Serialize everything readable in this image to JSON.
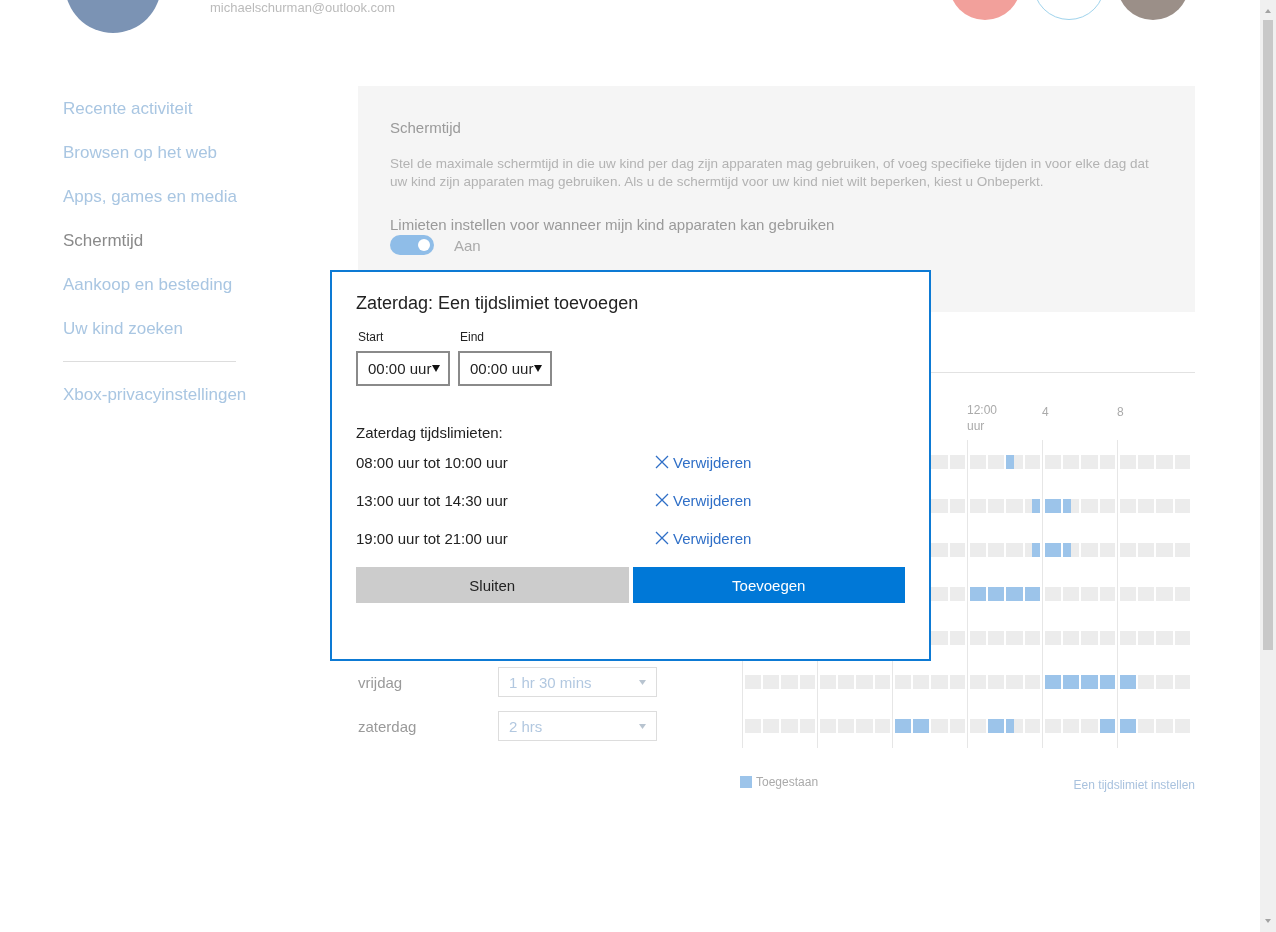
{
  "header": {
    "email": "michaelschurman@outlook.com"
  },
  "sidebar": {
    "items": [
      {
        "label": "Recente activiteit",
        "selected": false
      },
      {
        "label": "Browsen op het web",
        "selected": false
      },
      {
        "label": "Apps, games en media",
        "selected": false
      },
      {
        "label": "Schermtijd",
        "selected": true
      },
      {
        "label": "Aankoop en besteding",
        "selected": false
      },
      {
        "label": "Uw kind zoeken",
        "selected": false
      }
    ],
    "footer_items": [
      {
        "label": "Xbox-privacyinstellingen",
        "selected": false
      }
    ]
  },
  "panel": {
    "title": "Schermtijd",
    "description": "Stel de maximale schermtijd in die uw kind per dag zijn apparaten mag gebruiken, of voeg specifieke tijden in voor elke dag dat uw kind zijn apparaten mag gebruiken. Als u de schermtijd voor uw kind niet wilt beperken, kiest u Onbeperkt.",
    "setting_label": "Limieten instellen voor wanneer mijn kind apparaten kan gebruiken",
    "toggle": {
      "on": true,
      "label": "Aan"
    }
  },
  "schedule": {
    "hour_labels": [
      "12:00 uur",
      "4",
      "8"
    ],
    "rows": [
      {
        "allowed": [
          false,
          false,
          false,
          false,
          false,
          false,
          false,
          false,
          true,
          false,
          false,
          false,
          false,
          false,
          false,
          false,
          false,
          false,
          false,
          false,
          false,
          false,
          false,
          false,
          false,
          false,
          false,
          false
        ]
      },
      {
        "allowed": [
          false,
          false,
          false,
          false,
          false,
          false,
          false,
          false,
          false,
          false,
          false,
          true,
          true,
          true,
          true,
          false,
          false,
          false,
          false,
          false,
          false,
          false,
          false,
          false,
          false,
          false,
          false,
          false
        ]
      },
      {
        "allowed": [
          false,
          false,
          false,
          false,
          false,
          false,
          false,
          false,
          false,
          false,
          false,
          true,
          true,
          true,
          true,
          false,
          false,
          false,
          false,
          false,
          false,
          false,
          false,
          false,
          false,
          false,
          false,
          false
        ]
      },
      {
        "allowed": [
          false,
          false,
          false,
          false,
          true,
          true,
          true,
          true,
          true,
          true,
          true,
          true,
          false,
          false,
          false,
          false,
          false,
          false,
          false,
          false,
          false,
          false,
          false,
          false,
          false,
          false,
          false,
          false
        ]
      },
      {
        "allowed": [
          false,
          false,
          false,
          false,
          false,
          false,
          false,
          false,
          false,
          false,
          false,
          false,
          false,
          false,
          false,
          false,
          false,
          false,
          false,
          false,
          false,
          false,
          false,
          false,
          false,
          false,
          false,
          false
        ]
      },
      {
        "day": "vrijdag",
        "limit": "1 hr 30 mins",
        "allowed": [
          false,
          false,
          false,
          false,
          false,
          false,
          false,
          false,
          false,
          false,
          false,
          false,
          false,
          false,
          false,
          false,
          false,
          false,
          false,
          false,
          false,
          false,
          false,
          false,
          false,
          false,
          false,
          false,
          false,
          false,
          false,
          false,
          true,
          true,
          true,
          true,
          true,
          true,
          true,
          true,
          true,
          true,
          false,
          false,
          false,
          false,
          false,
          false
        ]
      },
      {
        "day": "zaterdag",
        "limit": "2 hrs",
        "allowed": [
          false,
          false,
          false,
          false,
          false,
          false,
          false,
          false,
          false,
          false,
          false,
          false,
          false,
          false,
          false,
          false,
          true,
          true,
          true,
          true,
          false,
          false,
          false,
          false,
          false,
          false,
          true,
          true,
          true,
          false,
          false,
          false,
          false,
          false,
          false,
          false,
          false,
          false,
          true,
          true,
          true,
          true,
          false,
          false,
          false,
          false,
          false,
          false
        ]
      }
    ],
    "legend": "Toegestaan",
    "link": "Een tijdslimiet instellen"
  },
  "dialog": {
    "title": "Zaterdag: Een tijdslimiet toevoegen",
    "start": {
      "label": "Start",
      "value": "00:00 uur"
    },
    "end": {
      "label": "Eind",
      "value": "00:00 uur"
    },
    "list_title": "Zaterdag tijdslimieten:",
    "limits": [
      {
        "range": "08:00 uur tot 10:00 uur",
        "action": "Verwijderen"
      },
      {
        "range": "13:00 uur tot 14:30 uur",
        "action": "Verwijderen"
      },
      {
        "range": "19:00 uur tot 21:00 uur",
        "action": "Verwijderen"
      }
    ],
    "buttons": [
      {
        "label": "Sluiten",
        "kind": "secondary"
      },
      {
        "label": "Toevoegen",
        "kind": "primary"
      }
    ]
  }
}
